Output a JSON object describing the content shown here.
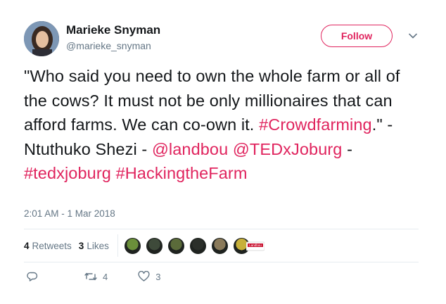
{
  "user": {
    "display_name": "Marieke Snyman",
    "handle": "@marieke_snyman"
  },
  "follow_button": {
    "label": "Follow"
  },
  "tweet": {
    "part1": "\"Who said you need to own the whole farm or all of the cows? It must not be only millionaires that can afford farms. We can co-own it. ",
    "hashtag_crowdfarming": "#Crowdfarming",
    "part2": ".\" - Ntuthuko Shezi - ",
    "mention_landbou": "@landbou",
    "mention_tedx": "@TEDxJoburg",
    "part3": " - ",
    "hashtag_tedx": "#tedxjoburg",
    "hashtag_hacking": "#HackingtheFarm"
  },
  "timestamp": "2:01 AM - 1 Mar 2018",
  "stats": {
    "retweets_count": "4",
    "retweets_label": "Retweets",
    "likes_count": "3",
    "likes_label": "Likes"
  },
  "likers": {
    "brand_label": "Landbou",
    "avatar_colors": [
      "#6b8f3a",
      "#3e4a3a",
      "#5b6b3a",
      "#2b2f2a",
      "#8a7a5a",
      "#c7b03a"
    ]
  },
  "actions": {
    "reply_icon": "reply-icon",
    "retweet_count": "4",
    "like_count": "3"
  },
  "colors": {
    "accent": "#e0245e",
    "muted": "#657786",
    "text": "#14171a",
    "divider": "#e6ecf0"
  }
}
